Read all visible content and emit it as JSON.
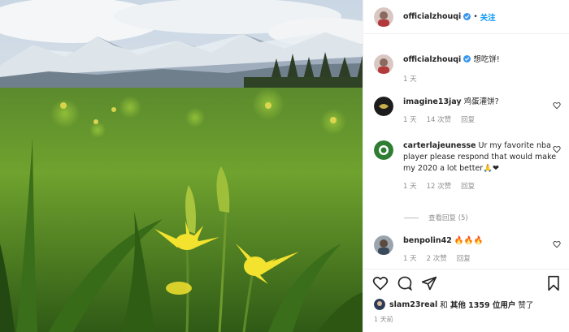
{
  "post": {
    "username": "officialzhouqi",
    "follow_label": "关注",
    "caption": "想吃饼!",
    "caption_age": "1 天"
  },
  "comments": [
    {
      "user": "imagine13jay",
      "text": "鸡蛋灌饼?",
      "age": "1 天",
      "likes": "14 次赞",
      "reply": "回复"
    },
    {
      "user": "carterlajeunesse",
      "text": "Ur my favorite nba player please respond that would make my 2020 a lot better🙏❤",
      "age": "1 天",
      "likes": "12 次赞",
      "reply": "回复"
    },
    {
      "user": "benpolin42",
      "text": "🔥🔥🔥",
      "age": "1 天",
      "likes": "2 次赞",
      "reply": "回复"
    }
  ],
  "view_replies": "查看回复 (5)",
  "likes": {
    "user": "slam23real",
    "and": "和",
    "others": "其他 1359 位用户",
    "suffix": "赞了"
  },
  "timestamp": "1 天前",
  "icons": [
    "verified-badge-icon",
    "heart-icon",
    "comment-icon",
    "share-icon",
    "bookmark-icon"
  ],
  "colors": {
    "accent": "#0095f6",
    "verified": "#3897f0",
    "muted": "#8e8e8e"
  }
}
